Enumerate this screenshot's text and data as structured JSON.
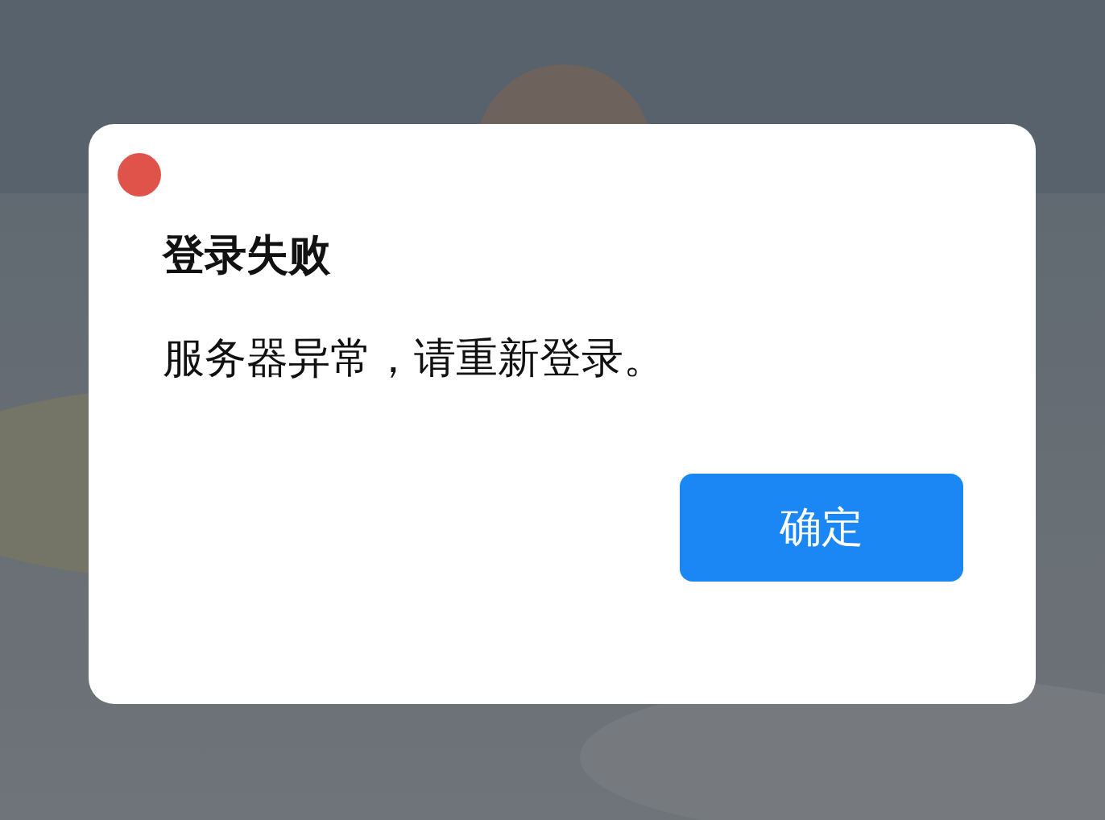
{
  "dialog": {
    "title": "登录失败",
    "message": "服务器异常，请重新登录。",
    "buttons": [
      {
        "label": "确定",
        "kind": "primary"
      }
    ]
  }
}
